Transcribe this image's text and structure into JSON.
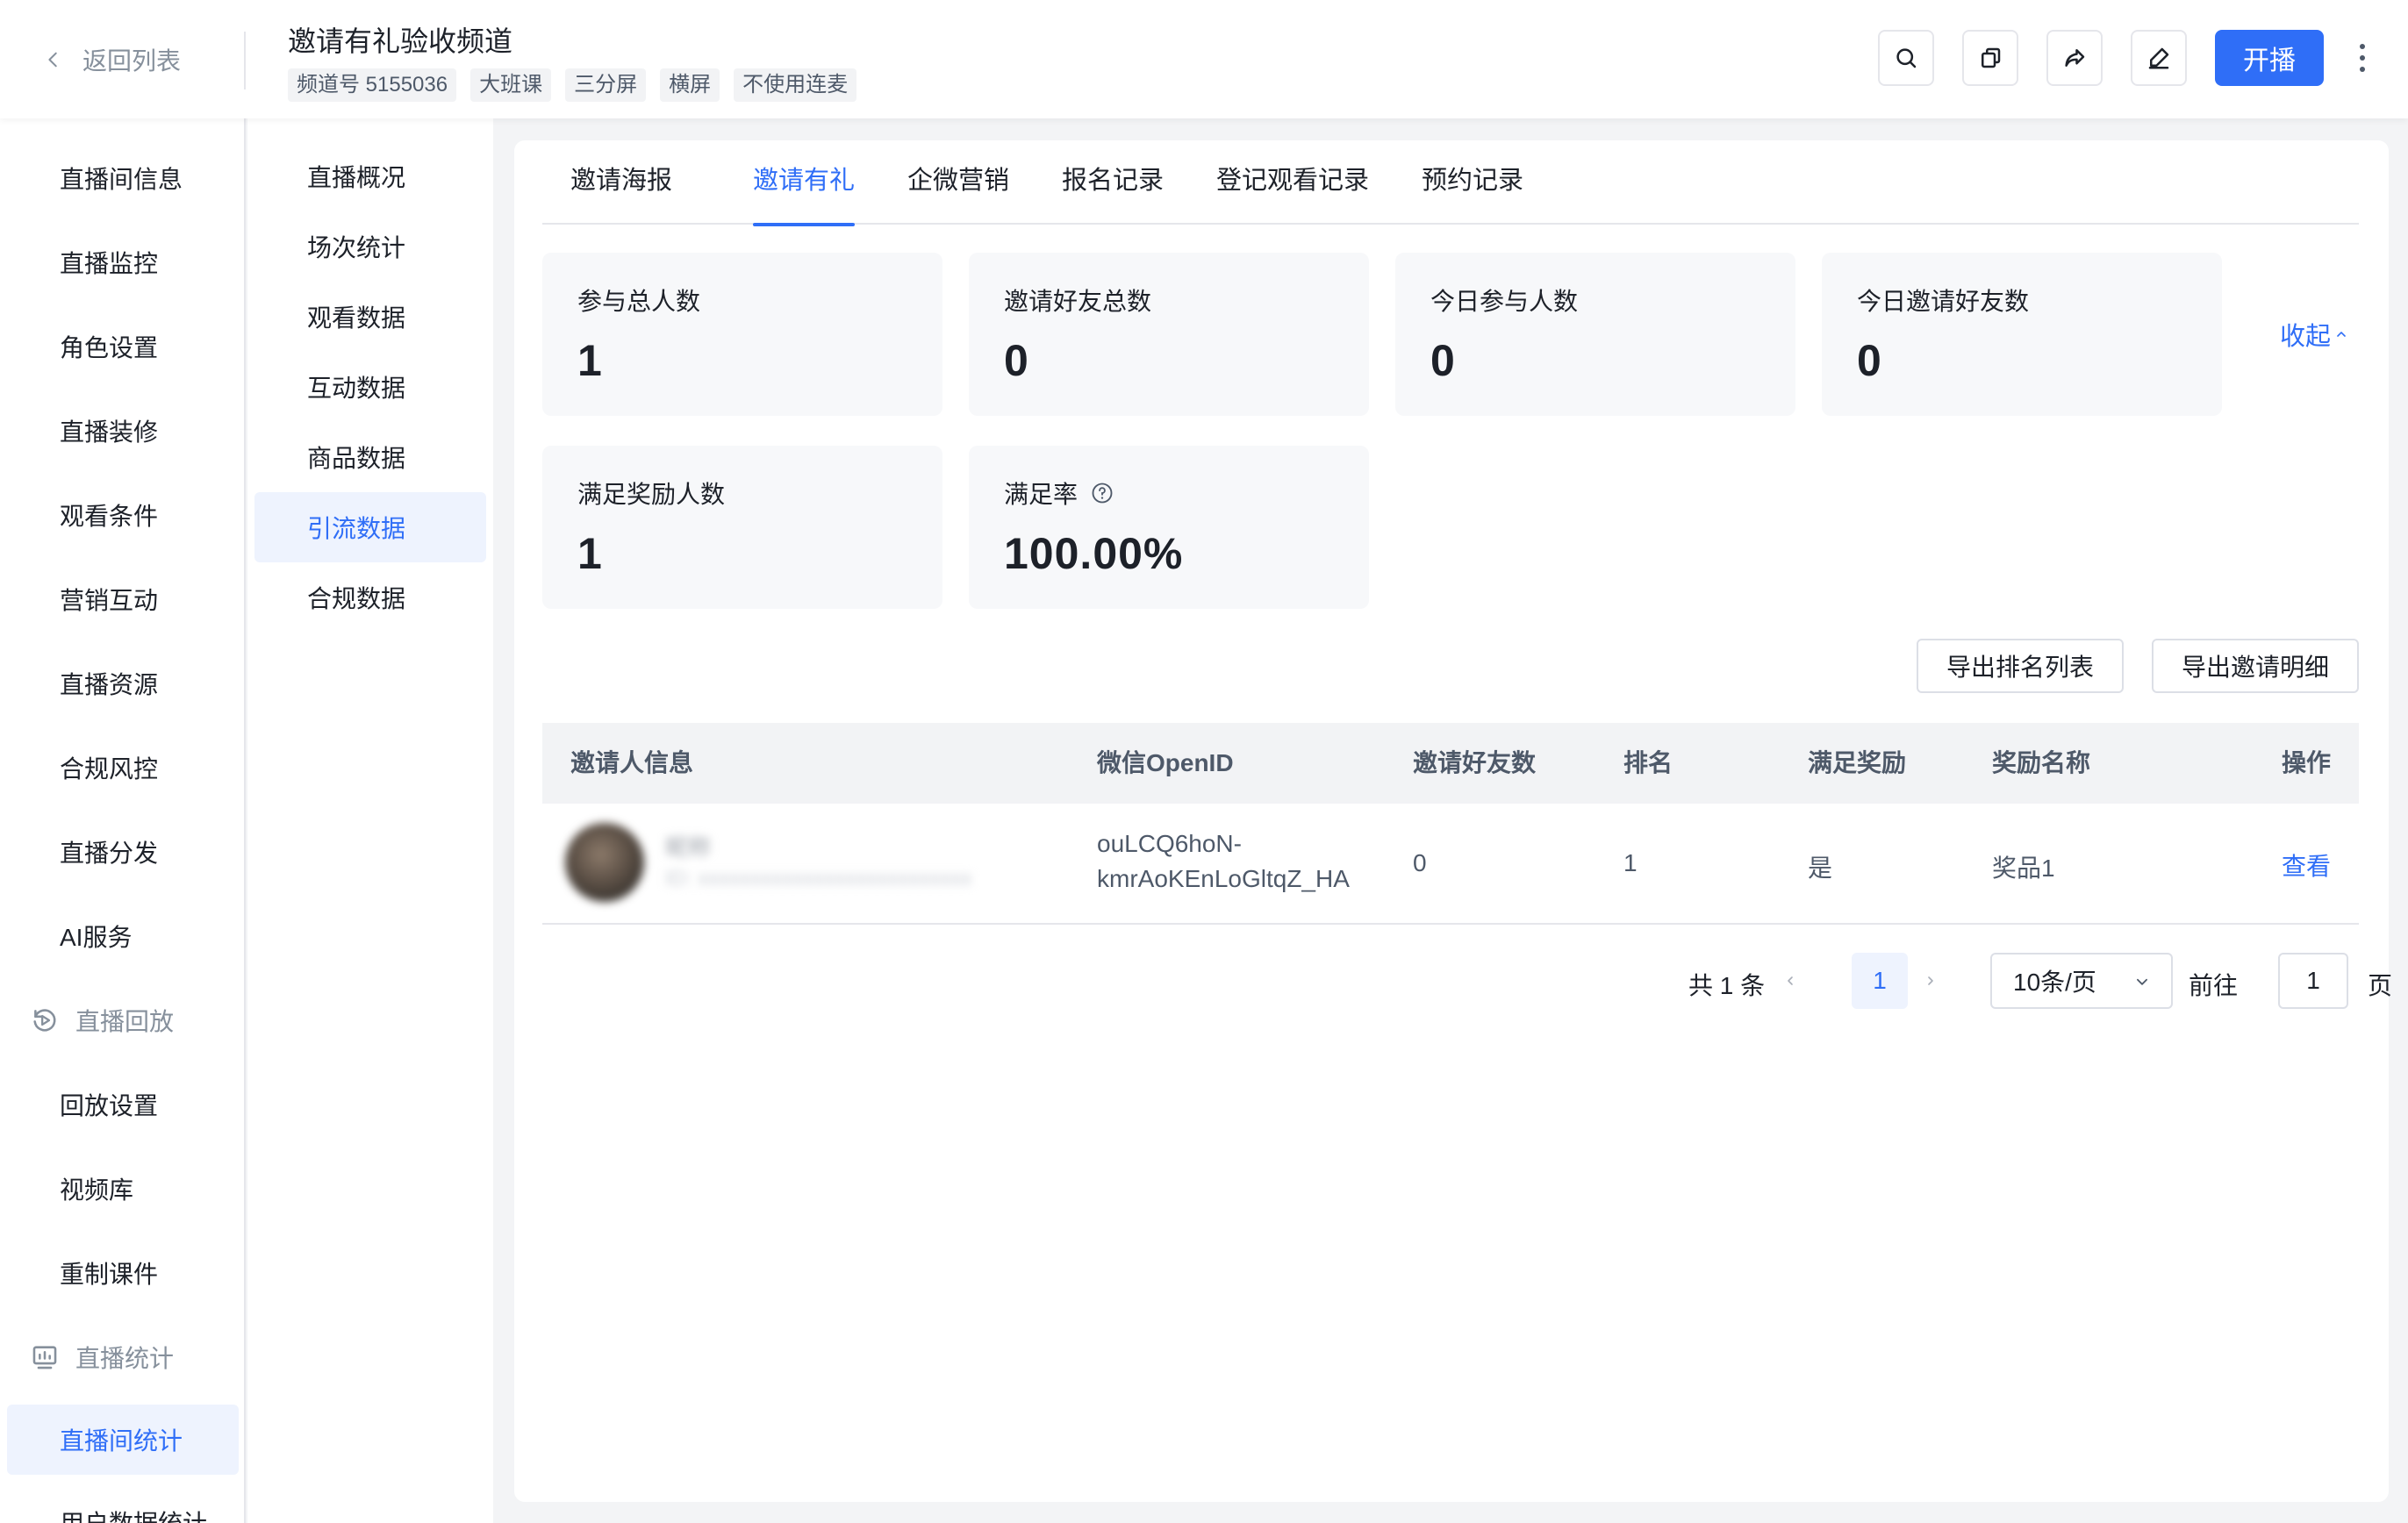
{
  "header": {
    "back_label": "返回列表",
    "channel_title": "邀请有礼验收频道",
    "tags": [
      "频道号 5155036",
      "大班课",
      "三分屏",
      "横屏",
      "不使用连麦"
    ],
    "start_label": "开播"
  },
  "nav1": {
    "items": [
      "直播间信息",
      "直播监控",
      "角色设置",
      "直播装修",
      "观看条件",
      "营销互动",
      "直播资源",
      "合规风控",
      "直播分发",
      "AI服务"
    ],
    "group_replay": "直播回放",
    "replay_items": [
      "回放设置",
      "视频库",
      "重制课件"
    ],
    "group_stats": "直播统计",
    "stats_items": [
      "直播间统计",
      "用户数据统计"
    ]
  },
  "nav2": {
    "items": [
      "直播概况",
      "场次统计",
      "观看数据",
      "互动数据",
      "商品数据",
      "引流数据",
      "合规数据"
    ],
    "active_index": 5
  },
  "tabs": [
    "邀请海报",
    "邀请有礼",
    "企微营销",
    "报名记录",
    "登记观看记录",
    "预约记录"
  ],
  "active_tab": "邀请有礼",
  "stats": [
    {
      "label": "参与总人数",
      "value": "1"
    },
    {
      "label": "邀请好友总数",
      "value": "0"
    },
    {
      "label": "今日参与人数",
      "value": "0"
    },
    {
      "label": "今日邀请好友数",
      "value": "0"
    },
    {
      "label": "满足奖励人数",
      "value": "1"
    },
    {
      "label": "满足率",
      "value": "100.00%"
    }
  ],
  "collapse_label": "收起",
  "export_buttons": {
    "rank": "导出排名列表",
    "detail": "导出邀请明细"
  },
  "table": {
    "columns": [
      "邀请人信息",
      "微信OpenID",
      "邀请好友数",
      "排名",
      "满足奖励",
      "奖励名称",
      "操作"
    ],
    "rows": [
      {
        "name": "昵称",
        "sub": "ID: xxxxxxxxxxxxxxxxxxxxxxxxxx",
        "openid_line1": "ouLCQ6hoN-",
        "openid_line2": "kmrAoKEnLoGltqZ_HA",
        "invites": "0",
        "rank": "1",
        "rewarded": "是",
        "reward_name": "奖品1",
        "action": "查看"
      }
    ]
  },
  "pagination": {
    "total": "共 1 条",
    "current": "1",
    "page_size": "10条/页",
    "goto_label": "前往",
    "goto_value": "1",
    "page_suffix": "页"
  },
  "colors": {
    "accent": "#2f6ef7",
    "active_bg": "#eef3fe",
    "card_bg": "#f7f8fa"
  }
}
